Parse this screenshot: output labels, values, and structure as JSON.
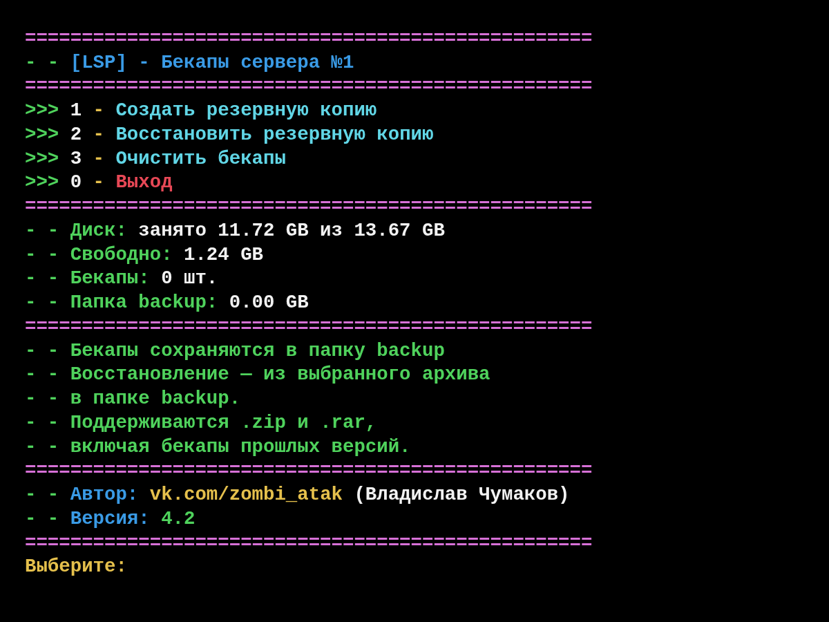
{
  "screen": {
    "blocks": [
      {
        "kind": "separator",
        "text": "=================================================="
      },
      {
        "kind": "title",
        "prefix": "- -",
        "text": "[LSP] - Бекапы сервера №1"
      },
      {
        "kind": "separator",
        "text": "=================================================="
      },
      {
        "kind": "menu",
        "items": [
          {
            "marker": ">>>",
            "number": "1",
            "dash": "-",
            "label": "Создать резервную копию",
            "color": "#61d6e6"
          },
          {
            "marker": ">>>",
            "number": "2",
            "dash": "-",
            "label": "Восстановить резервную копию",
            "color": "#61d6e6"
          },
          {
            "marker": ">>>",
            "number": "3",
            "dash": "-",
            "label": "Очистить бекапы",
            "color": "#61d6e6"
          },
          {
            "marker": ">>>",
            "number": "0",
            "dash": "-",
            "label": "Выход",
            "color": "#e74856"
          }
        ]
      },
      {
        "kind": "separator",
        "text": "=================================================="
      },
      {
        "kind": "stats",
        "items": [
          {
            "prefix": "- -",
            "label": "Диск:",
            "value": "занято 11.72 GB из 13.67 GB"
          },
          {
            "prefix": "- -",
            "label": "Свободно:",
            "value": "1.24 GB"
          },
          {
            "prefix": "- -",
            "label": "Бекапы:",
            "value": "0 шт."
          },
          {
            "prefix": "- -",
            "label": "Папка backup:",
            "value": "0.00 GB"
          }
        ]
      },
      {
        "kind": "separator",
        "text": "=================================================="
      },
      {
        "kind": "notes",
        "items": [
          {
            "prefix": "- -",
            "text": "Бекапы сохраняются в папку backup"
          },
          {
            "prefix": "- -",
            "text": "Восстановление — из выбранного архива"
          },
          {
            "prefix": "- -",
            "text": "в папке backup."
          },
          {
            "prefix": "- -",
            "text": "Поддерживаются .zip и .rar,"
          },
          {
            "prefix": "- -",
            "text": "включая бекапы прошлых версий."
          }
        ]
      },
      {
        "kind": "separator",
        "text": "=================================================="
      },
      {
        "kind": "about",
        "items": [
          {
            "prefix": "- -",
            "label": "Автор:",
            "value": "vk.com/zombi_atak",
            "color": "#e5c04c",
            "extra": "(Владислав Чумаков)"
          },
          {
            "prefix": "- -",
            "label": "Версия:",
            "value": "4.2",
            "color": "#4fd25c"
          }
        ]
      },
      {
        "kind": "separator",
        "text": "=================================================="
      },
      {
        "kind": "prompt",
        "text": "Выберите:"
      }
    ]
  }
}
